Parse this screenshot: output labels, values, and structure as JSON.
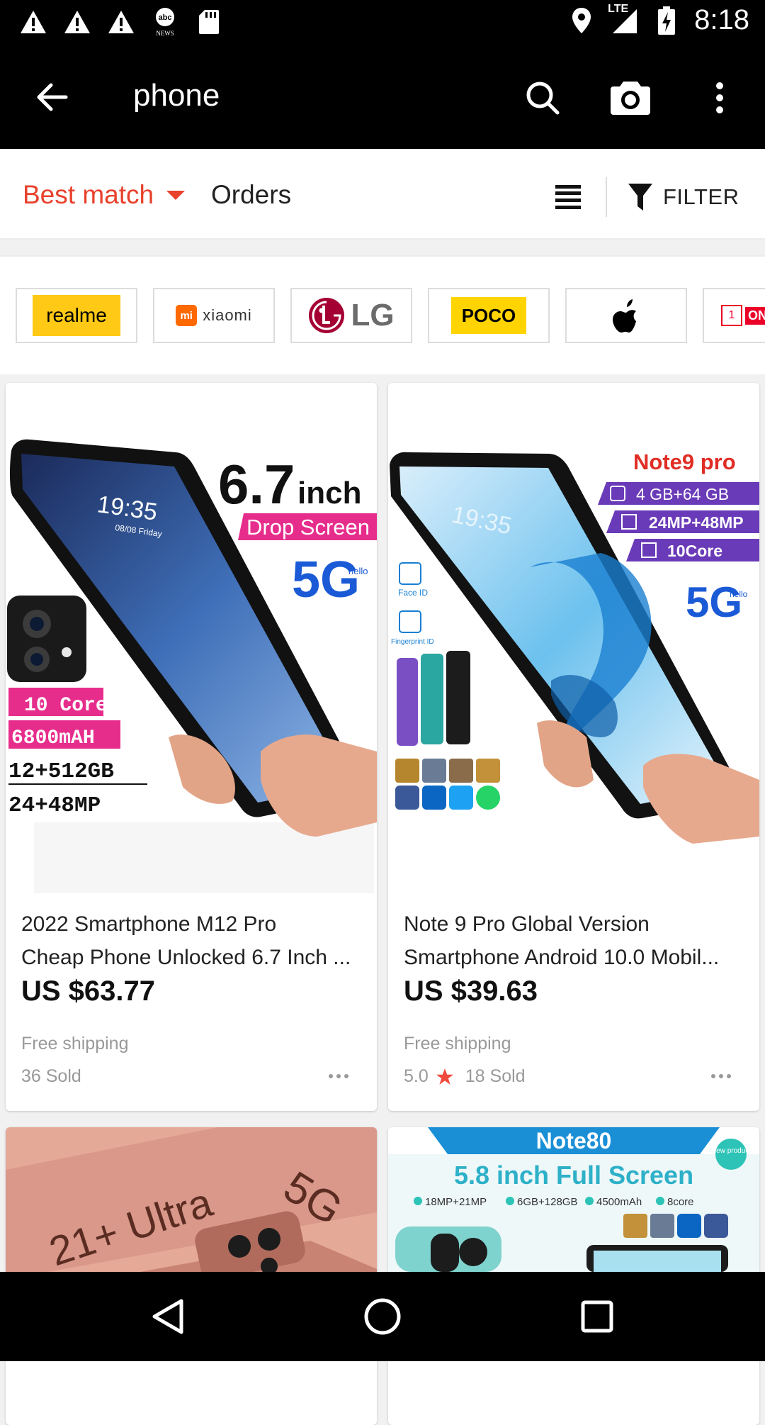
{
  "status_bar": {
    "time": "8:18",
    "network_label": "LTE",
    "left_icons": [
      "warning-icon",
      "warning-icon",
      "warning-icon",
      "abc-news-icon",
      "sd-card-icon"
    ],
    "right_icons": [
      "location-icon",
      "signal-icon",
      "battery-charging-icon"
    ]
  },
  "toolbar": {
    "query": "phone",
    "icons": [
      "back-arrow-icon",
      "search-icon",
      "camera-icon",
      "more-vert-icon"
    ]
  },
  "sort_bar": {
    "best_match": "Best match",
    "orders": "Orders",
    "filter": "FILTER"
  },
  "brands": [
    "realme",
    "xiaomi",
    "LG",
    "POCO",
    "Apple",
    "ON"
  ],
  "products": [
    {
      "image_text": {
        "size": "6.7",
        "unit": "inch",
        "ribbon": "Drop Screen",
        "network": "5G",
        "hello": "hello",
        "lockscreen_time": "19:35",
        "lockscreen_date": "08/08 Friday",
        "specs": [
          "10 Core",
          "6800mAH",
          "12+512GB",
          "24+48MP"
        ]
      },
      "title_line1": "2022 Smartphone M12 Pro",
      "title_line2": "Cheap Phone Unlocked 6.7 Inch ...",
      "price": "US $63.77",
      "shipping": "Free shipping",
      "rating": "",
      "sold": "36 Sold"
    },
    {
      "image_text": {
        "model": "Note9 pro",
        "specs": [
          "4 GB+64 GB",
          "24MP+48MP",
          "10Core"
        ],
        "network": "5G",
        "hello": "hello",
        "face_id": "Face ID",
        "fingerprint_id": "Fingerprint ID",
        "lockscreen_time": "19:35"
      },
      "title_line1": "Note 9 Pro Global Version",
      "title_line2": "Smartphone Android 10.0 Mobil...",
      "price": "US $39.63",
      "shipping": "Free shipping",
      "rating": "5.0",
      "sold": "18 Sold"
    },
    {
      "image_text": {
        "model": "21+ Ultra",
        "network": "5G"
      }
    },
    {
      "image_text": {
        "model": "Note80",
        "headline": "5.8 inch Full Screen",
        "badge": "New product",
        "specs": [
          "18MP+21MP",
          "6GB+128GB",
          "4500mAh",
          "8core"
        ]
      }
    }
  ],
  "nav_bar": {
    "icons": [
      "back-triangle-icon",
      "home-circle-icon",
      "recents-square-icon"
    ]
  },
  "colors": {
    "accent": "#e8412c",
    "star": "#f0493e",
    "toolbar_bg": "#000000",
    "realme_yellow": "#ffc915",
    "poco_yellow": "#ffd400",
    "lg_red": "#a50034"
  }
}
